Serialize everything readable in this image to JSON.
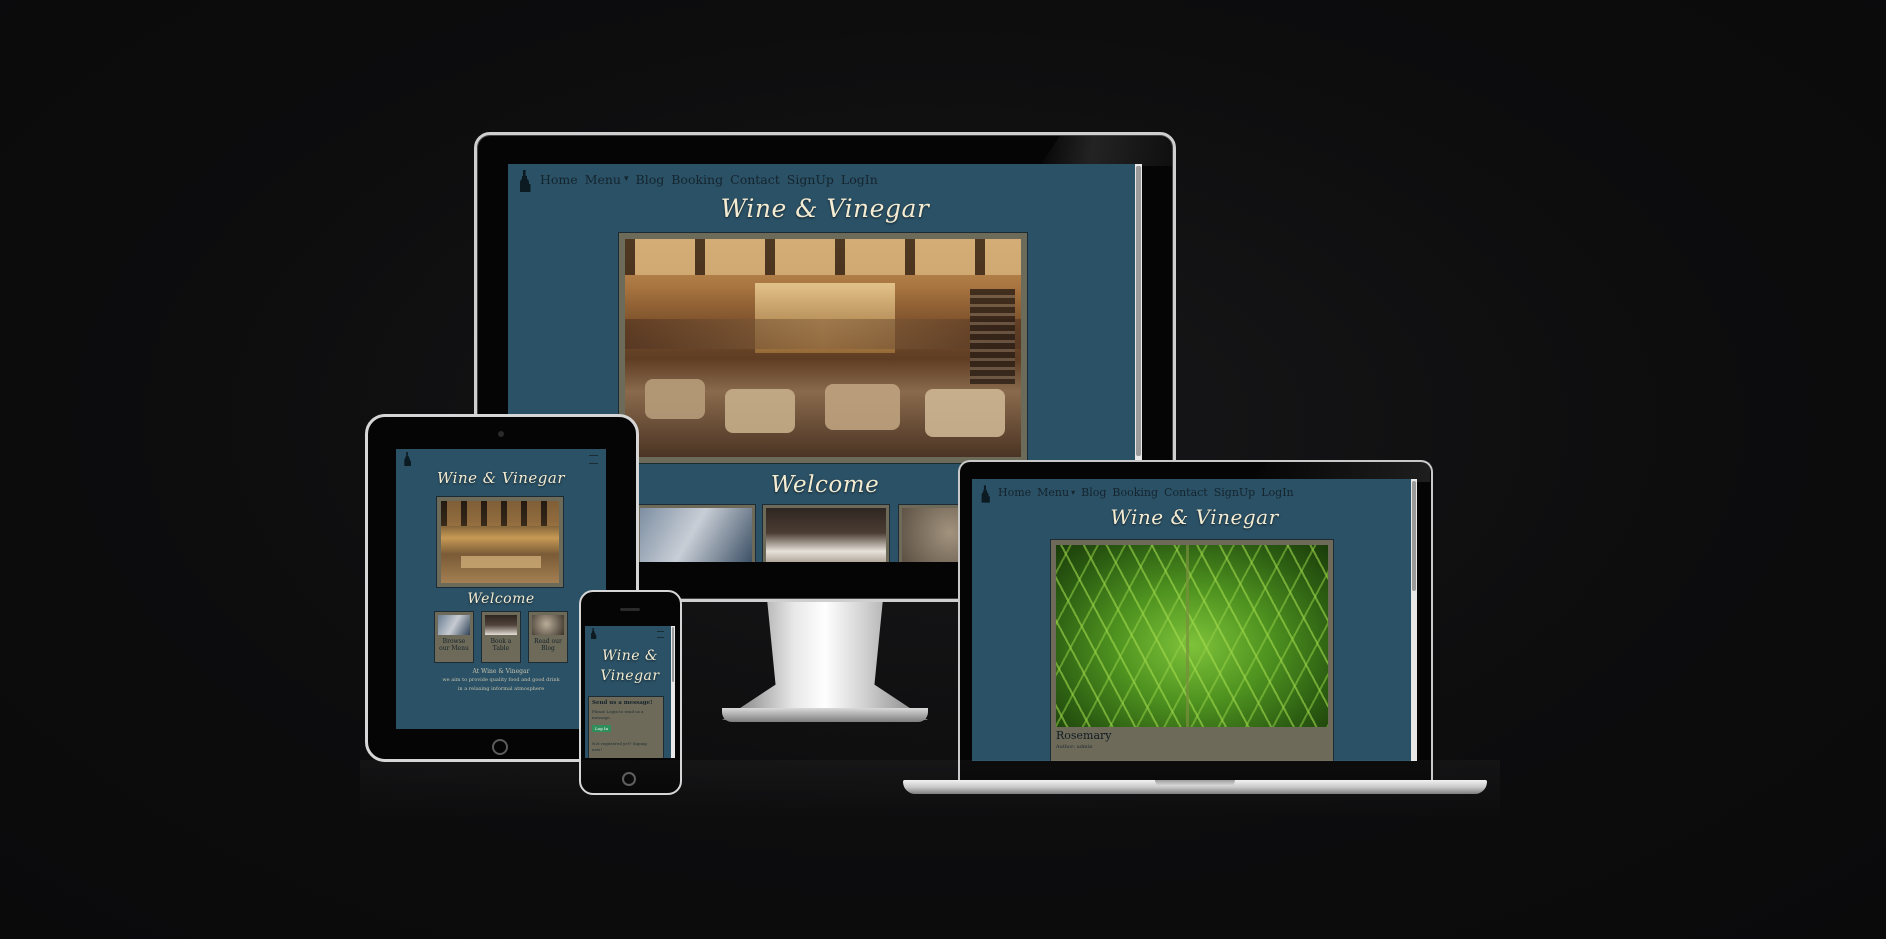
{
  "brand_color": "#2b5166",
  "card_color": "#6e6a59",
  "title_color": "#f3ecd2",
  "nav": {
    "items": [
      "Home",
      "Menu",
      "Blog",
      "Booking",
      "Contact",
      "SignUp",
      "LogIn"
    ],
    "menu_caret": "▾",
    "logo_icon": "wine-bottle-icon"
  },
  "site_title": "Wine & Vinegar",
  "welcome_heading": "Welcome",
  "tablet": {
    "title": "Wine & Vinegar",
    "welcome": "Welcome",
    "cards": [
      {
        "label_line1": "Browse",
        "label_line2": "our Menu"
      },
      {
        "label_line1": "Book a",
        "label_line2": "Table"
      },
      {
        "label_line1": "Read our",
        "label_line2": "Blog"
      }
    ],
    "intro_line1": "At Wine & Vinegar",
    "intro_line2": "we aim to provide quality food and good drink",
    "intro_line3": "in a relaxing informal atmosphere"
  },
  "phone": {
    "title_line1": "Wine &",
    "title_line2": "Vinegar",
    "form_title": "Send us a message!",
    "form_note": "Please Login to send us a message.",
    "login_button": "Log In",
    "footer_note": "Not registered yet? Signup now!"
  },
  "laptop": {
    "title": "Wine & Vinegar",
    "herb_name": "Rosemary",
    "herb_author": "Author: admin"
  }
}
